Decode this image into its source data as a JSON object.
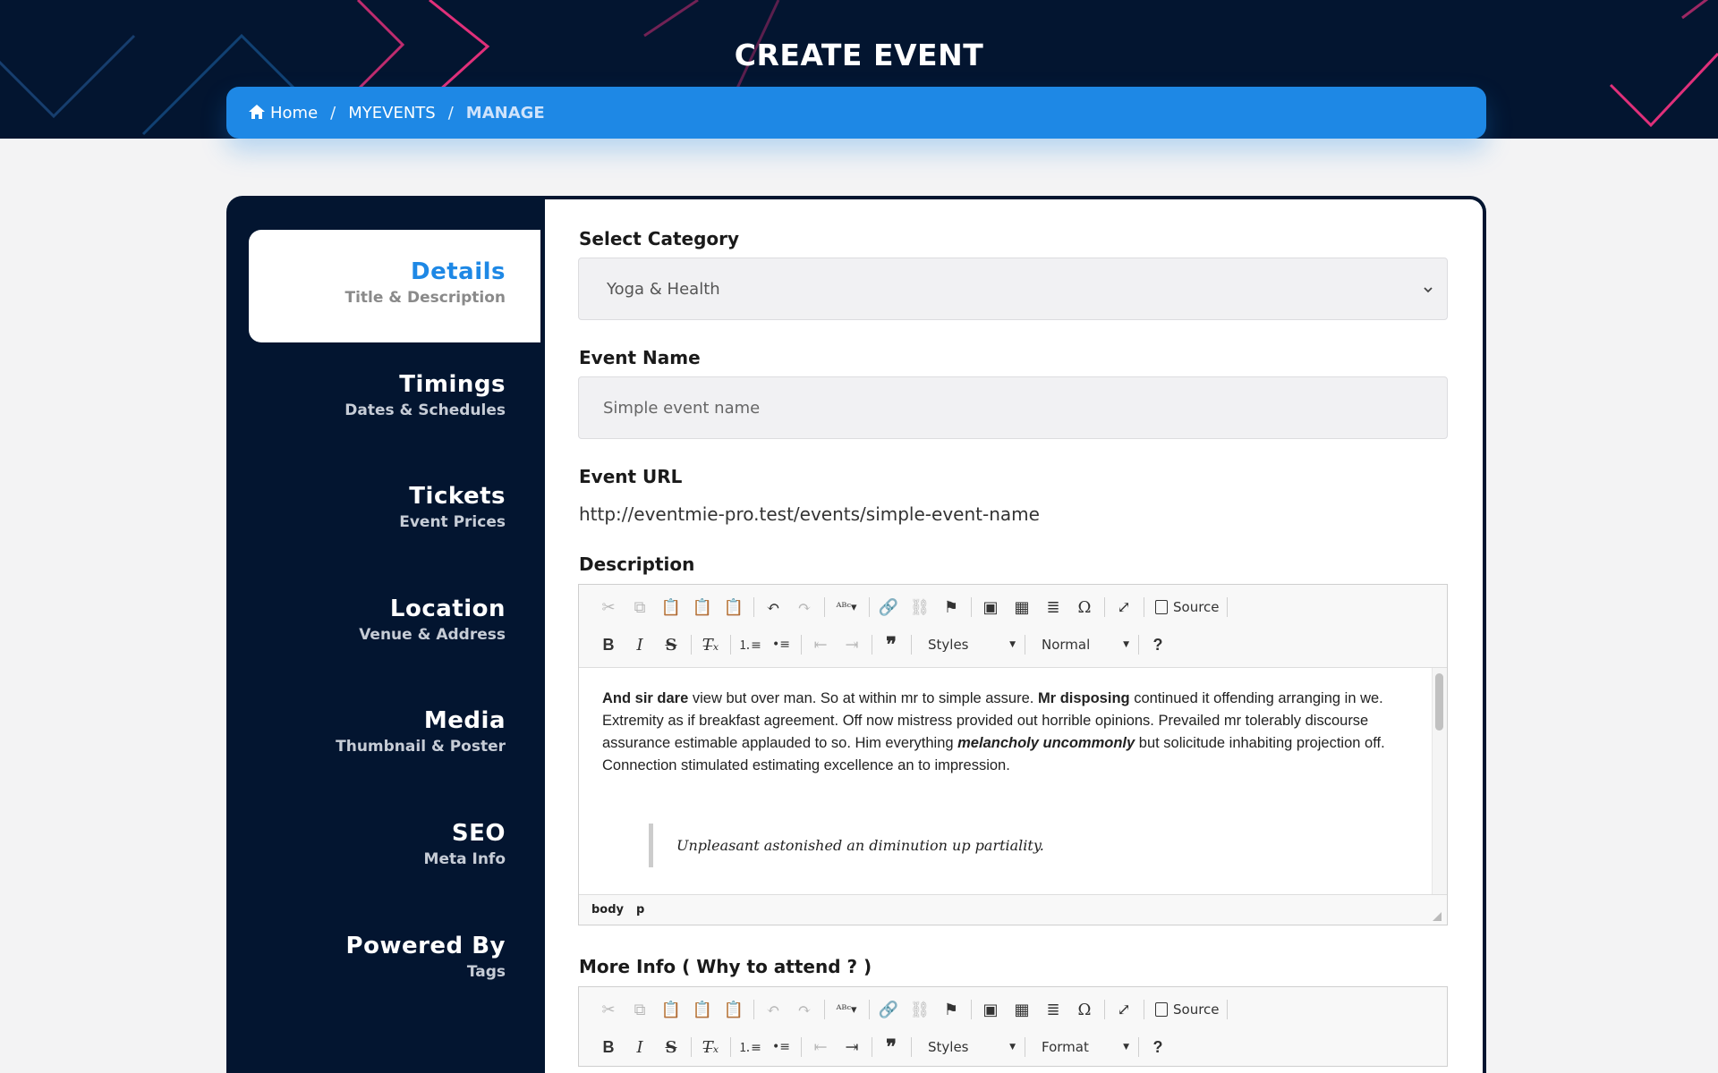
{
  "header": {
    "title": "CREATE EVENT",
    "breadcrumb": [
      {
        "label": "Home",
        "icon": "home-icon"
      },
      {
        "label": "MYEVENTS"
      },
      {
        "label": "MANAGE"
      }
    ]
  },
  "sidebar": {
    "items": [
      {
        "title": "Details",
        "subtitle": "Title & Description",
        "active": true
      },
      {
        "title": "Timings",
        "subtitle": "Dates & Schedules"
      },
      {
        "title": "Tickets",
        "subtitle": "Event Prices"
      },
      {
        "title": "Location",
        "subtitle": "Venue & Address"
      },
      {
        "title": "Media",
        "subtitle": "Thumbnail & Poster"
      },
      {
        "title": "SEO",
        "subtitle": "Meta Info"
      },
      {
        "title": "Powered By",
        "subtitle": "Tags"
      }
    ]
  },
  "form": {
    "category_label": "Select Category",
    "category_value": "Yoga & Health",
    "event_name_label": "Event Name",
    "event_name_placeholder": "Simple event name",
    "event_url_label": "Event URL",
    "event_url_value": "http://eventmie-pro.test/events/simple-event-name",
    "description_label": "Description",
    "more_info_label": "More Info ( Why to attend ? )"
  },
  "editor": {
    "source_label": "Source",
    "styles_label": "Styles",
    "format_value_1": "Normal",
    "format_value_2": "Format",
    "help_label": "?",
    "path": [
      "body",
      "p"
    ],
    "content": {
      "bold_1": "And sir dare",
      "text_1": " view but over man. So at within mr to simple assure. ",
      "bold_2": "Mr disposing",
      "text_2": " continued it offending arranging in we. Extremity as if breakfast agreement. Off now mistress provided out horrible opinions. Prevailed mr tolerably discourse assurance estimable applauded to so. Him everything ",
      "bold_italic": "melancholy uncommonly",
      "text_3": " but solicitude inhabiting projection off. Connection stimulated estimating excellence an to impression.",
      "quote": "Unpleasant astonished an diminution up partiality."
    }
  },
  "colors": {
    "header_bg": "#031530",
    "accent": "#1e88e5",
    "deco_pink": "#e0307a",
    "deco_blue": "#1b5fa0"
  }
}
